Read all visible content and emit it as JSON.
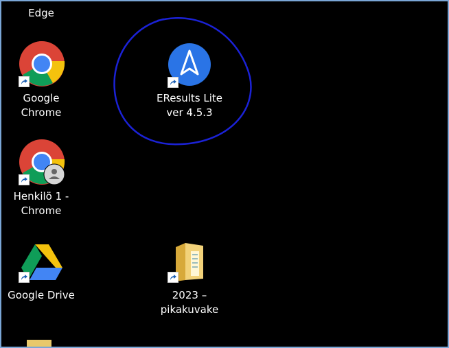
{
  "desktop": {
    "icons": [
      {
        "id": "edge",
        "label_lines": [
          "Edge"
        ]
      },
      {
        "id": "google-chrome",
        "label_lines": [
          "Google",
          "Chrome"
        ]
      },
      {
        "id": "henkilo-chrome",
        "label_lines": [
          "Henkilö 1 -",
          "Chrome"
        ]
      },
      {
        "id": "google-drive",
        "label_lines": [
          "Google Drive"
        ]
      },
      {
        "id": "eresults-lite",
        "label_lines": [
          "EResults Lite",
          "ver 4.5.3"
        ]
      },
      {
        "id": "folder-2023",
        "label_lines": [
          "2023 –",
          "pikakuvake"
        ]
      }
    ]
  },
  "colors": {
    "background": "#000000",
    "frame_border": "#7aa6d6",
    "annotation_circle": "#1b22d6",
    "eresults_blue": "#2a74e6"
  },
  "icons": {
    "edge": "edge-icon",
    "chrome": "chrome-icon",
    "chrome_profile": "chrome-profile-icon",
    "drive": "google-drive-icon",
    "eresults": "eresults-icon",
    "folder": "folder-icon",
    "shortcut": "shortcut-arrow-icon"
  }
}
